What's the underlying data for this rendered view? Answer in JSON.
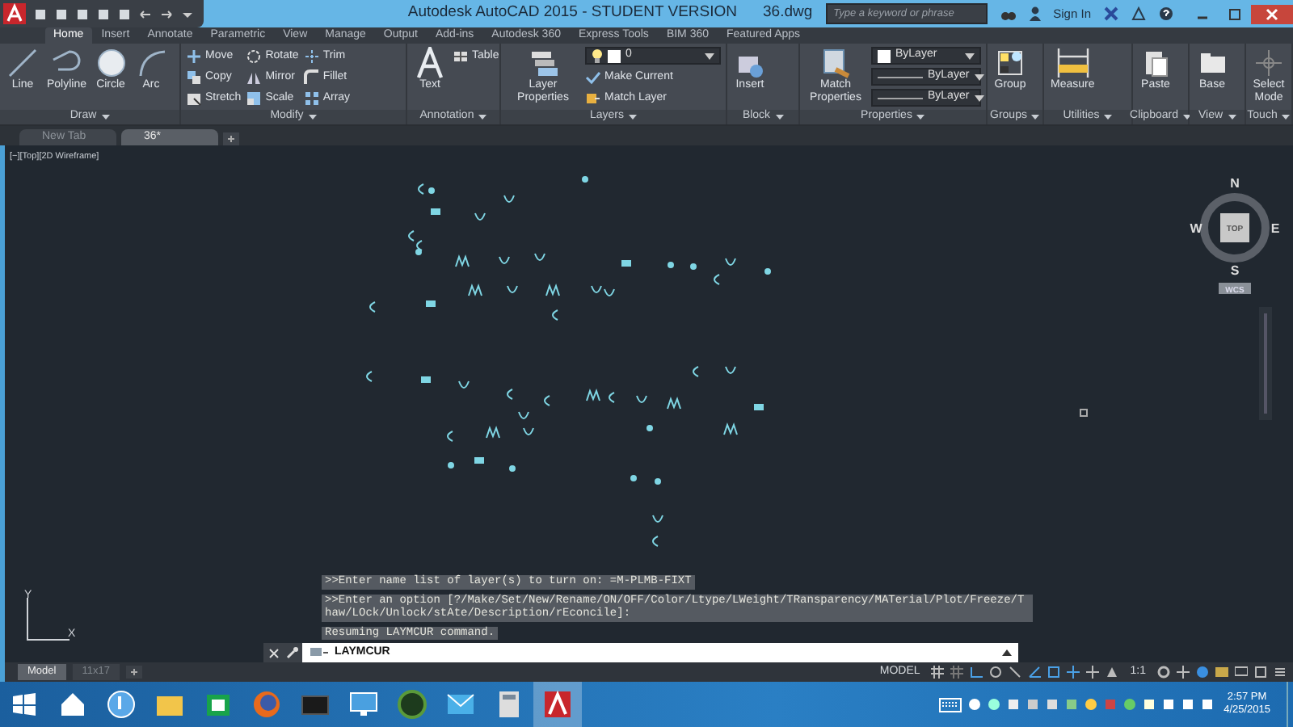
{
  "title_bar": {
    "title": "Autodesk AutoCAD 2015 - STUDENT VERSION",
    "file": "36.dwg",
    "search": {
      "placeholder": "Type a keyword or phrase"
    },
    "sign_in": "Sign In"
  },
  "ribbon_tabs": [
    {
      "label": "Home",
      "selected": true
    },
    {
      "label": "Insert",
      "selected": false
    },
    {
      "label": "Annotate",
      "selected": false
    },
    {
      "label": "Parametric",
      "selected": false
    },
    {
      "label": "View",
      "selected": false
    },
    {
      "label": "Manage",
      "selected": false
    },
    {
      "label": "Output",
      "selected": false
    },
    {
      "label": "Add-ins",
      "selected": false
    },
    {
      "label": "Autodesk 360",
      "selected": false
    },
    {
      "label": "Express Tools",
      "selected": false
    },
    {
      "label": "BIM 360",
      "selected": false
    },
    {
      "label": "Featured Apps",
      "selected": false
    }
  ],
  "ribbon_panels": [
    {
      "title": "Draw",
      "tools": [
        {
          "kind": "large",
          "label": "Line"
        },
        {
          "kind": "large",
          "label": "Polyline"
        },
        {
          "kind": "large",
          "label": "Circle"
        },
        {
          "kind": "large",
          "label": "Arc"
        }
      ]
    },
    {
      "title": "Modify",
      "tools": [
        {
          "kind": "small",
          "label": "Move"
        },
        {
          "kind": "small",
          "label": "Copy"
        },
        {
          "kind": "small",
          "label": "Stretch"
        },
        {
          "kind": "small",
          "label": "Rotate"
        },
        {
          "kind": "small",
          "label": "Mirror"
        },
        {
          "kind": "small",
          "label": "Scale"
        },
        {
          "kind": "small",
          "label": "Trim"
        },
        {
          "kind": "small",
          "label": "Fillet"
        },
        {
          "kind": "small",
          "label": "Array"
        }
      ]
    },
    {
      "title": "Annotation",
      "tools": [
        {
          "kind": "large",
          "label": "Text"
        },
        {
          "kind": "small",
          "label": "Table"
        }
      ]
    },
    {
      "title": "Layers",
      "tools": [
        {
          "kind": "large",
          "label": "Layer Properties"
        },
        {
          "kind": "combo",
          "value": "0"
        },
        {
          "kind": "small",
          "label": "Make Current"
        },
        {
          "kind": "small",
          "label": "Match Layer"
        }
      ]
    },
    {
      "title": "Block",
      "tools": [
        {
          "kind": "large",
          "label": "Insert"
        }
      ]
    },
    {
      "title": "Properties",
      "tools": [
        {
          "kind": "large",
          "label": "Match Properties"
        },
        {
          "kind": "combo",
          "value": "ByLayer"
        },
        {
          "kind": "combo",
          "value": "ByLayer"
        },
        {
          "kind": "combo",
          "value": "ByLayer"
        }
      ]
    },
    {
      "title": "Groups",
      "tools": [
        {
          "kind": "large",
          "label": "Group"
        }
      ]
    },
    {
      "title": "Utilities",
      "tools": [
        {
          "kind": "large",
          "label": "Measure"
        }
      ]
    },
    {
      "title": "Clipboard",
      "tools": [
        {
          "kind": "large",
          "label": "Paste"
        }
      ]
    },
    {
      "title": "View",
      "tools": [
        {
          "kind": "large",
          "label": "Base"
        }
      ]
    },
    {
      "title": "Touch",
      "tools": [
        {
          "kind": "large",
          "label": "Select Mode"
        }
      ]
    }
  ],
  "file_tabs": [
    {
      "label": "New Tab",
      "selected": false
    },
    {
      "label": "36*",
      "selected": true
    }
  ],
  "viewport_label": "[−][Top][2D Wireframe]",
  "viewcube": {
    "north": "N",
    "south": "S",
    "east": "E",
    "west": "W",
    "face": "TOP",
    "coordinate_system": "WCS"
  },
  "ucs": {
    "x_label": "X",
    "y_label": "Y"
  },
  "command_history": [
    ">>Enter name list of layer(s) to turn on: =M-PLMB-FIXT",
    ">>Enter an option [?/Make/Set/New/Rename/ON/OFF/Color/Ltype/LWeight/TRansparency/MATerial/Plot/Freeze/Thaw/LOck/Unlock/stAte/Description/rEconcile]:",
    "Resuming LAYMCUR command."
  ],
  "command_line": {
    "value": "LAYMCUR"
  },
  "layout_tabs": [
    {
      "label": "Model",
      "selected": true
    },
    {
      "label": "11x17",
      "selected": false
    }
  ],
  "status_bar": {
    "space": "MODEL",
    "scale": "1:1"
  },
  "taskbar": {
    "apps": [
      {
        "selected": false
      },
      {
        "selected": false
      },
      {
        "selected": false
      },
      {
        "selected": false
      },
      {
        "selected": false
      },
      {
        "selected": false
      },
      {
        "selected": false
      },
      {
        "selected": false
      },
      {
        "selected": false
      },
      {
        "selected": false
      },
      {
        "selected": true
      }
    ],
    "time": "2:57 PM",
    "date": "4/25/2015"
  }
}
